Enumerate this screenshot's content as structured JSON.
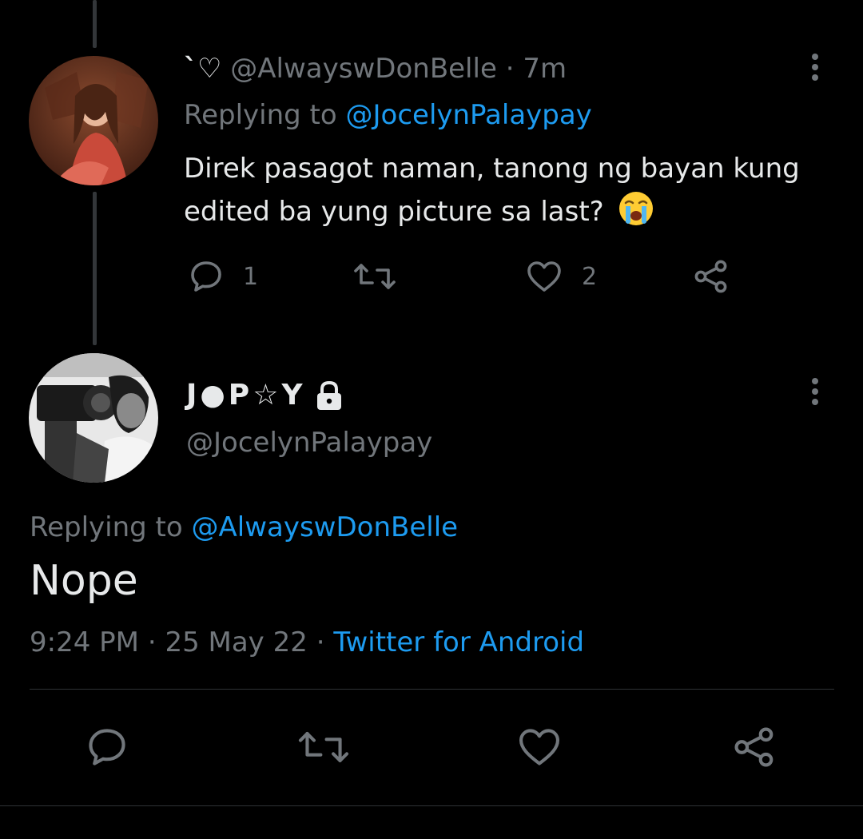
{
  "tweet1": {
    "name_glyph": "`♡",
    "handle": "@AlwayswDonBelle",
    "separator": "·",
    "time": "7m",
    "replying_prefix": "Replying to",
    "replying_to": "@JocelynPalaypay",
    "text": "Direk pasagot naman, tanong ng bayan kung edited ba yung picture sa last?",
    "emoji": "loudly-crying-face",
    "reply_count": "1",
    "retweet_count": "",
    "like_count": "2"
  },
  "tweet2": {
    "display_name": "J●P☆Y",
    "protected_icon": "lock-icon",
    "handle": "@JocelynPalaypay",
    "replying_prefix": "Replying to",
    "replying_to": "@AlwayswDonBelle",
    "text": "Nope",
    "time": "9:24 PM",
    "dot1": "·",
    "date": "25 May 22",
    "dot2": "·",
    "source": "Twitter for Android"
  },
  "icons": {
    "reply": "reply-icon",
    "retweet": "retweet-icon",
    "like": "heart-icon",
    "share": "share-icon",
    "more": "more-vertical-icon"
  },
  "colors": {
    "background": "#000000",
    "text": "#e7e9ea",
    "secondary": "#71767b",
    "link": "#1d9bf0"
  }
}
